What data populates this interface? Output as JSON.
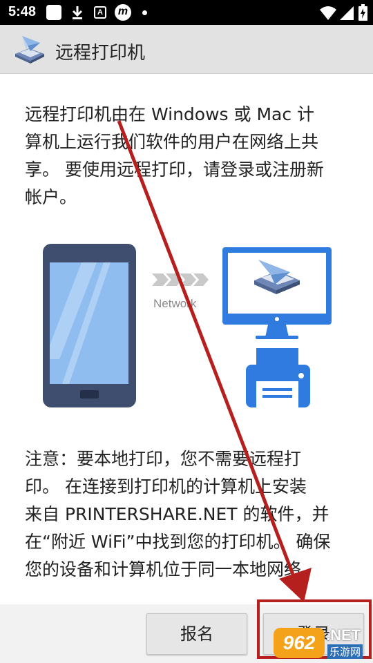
{
  "status_bar": {
    "time": "5:48",
    "icons": [
      "notification-square-icon",
      "download-icon",
      "a-icon",
      "m-icon",
      "dot-icon",
      "wifi-icon",
      "signal-icon",
      "battery-icon"
    ]
  },
  "app_bar": {
    "title": "远程打印机",
    "logo_icon": "printer-paper-plane-icon"
  },
  "content": {
    "intro_lines": [
      "远程打印机由在 Windows 或 Mac 计",
      "算机上运行我们软件的用户在网络上共",
      "享。 要使用远程打印，请登录或注册新",
      "帐户。"
    ],
    "network_label": "Network",
    "note_lines": [
      "注意：要本地打印，您不需要远程打",
      "印。 在连接到打印机的计算机上安装",
      "来自 PRINTERSHARE.NET 的软件，并",
      "在“附近 WiFi”中找到您的打印机。 确保",
      "您的设备和计算机位于同一本地网络。"
    ]
  },
  "buttons": {
    "register_label": "报名",
    "login_label": "登录"
  },
  "watermark": {
    "badge": "962",
    "net": ".NET",
    "site": "乐游网"
  },
  "colors": {
    "annotation_red": "#b5201f",
    "phone_body": "#3f4e6e",
    "screen_blue": "#8fbdf0",
    "accent_blue": "#2f7be0"
  }
}
